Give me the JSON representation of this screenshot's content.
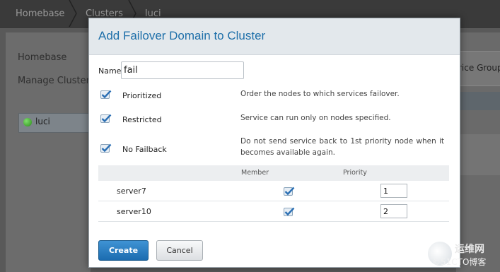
{
  "breadcrumb": {
    "items": [
      "Homebase",
      "Clusters",
      "luci"
    ]
  },
  "sidebar": {
    "items": [
      {
        "label": "Homebase"
      },
      {
        "label": "Manage Clusters"
      }
    ],
    "clusters": [
      {
        "label": "luci",
        "status": "online"
      }
    ]
  },
  "background": {
    "right_partial_text": "rice Group"
  },
  "dialog": {
    "title": "Add Failover Domain to Cluster",
    "name_label": "Name",
    "name_value": "fail",
    "options": [
      {
        "label": "Prioritized",
        "checked": true,
        "description": "Order the nodes to which services failover."
      },
      {
        "label": "Restricted",
        "checked": true,
        "description": "Service can run only on nodes specified."
      },
      {
        "label": "No Failback",
        "checked": true,
        "description": "Do not send service back to 1st priority node when it becomes available again."
      }
    ],
    "table": {
      "headers": {
        "member": "Member",
        "priority": "Priority"
      },
      "rows": [
        {
          "name": "server7",
          "member": true,
          "priority": "1"
        },
        {
          "name": "server10",
          "member": true,
          "priority": "2"
        }
      ]
    },
    "buttons": {
      "create": "Create",
      "cancel": "Cancel"
    }
  },
  "watermark": {
    "line1": "运维网",
    "line2": "©51CTO博客"
  },
  "colors": {
    "accent": "#1e6fa9",
    "primary_button": "#1b6cb0",
    "status_online": "#2b8a1a"
  }
}
